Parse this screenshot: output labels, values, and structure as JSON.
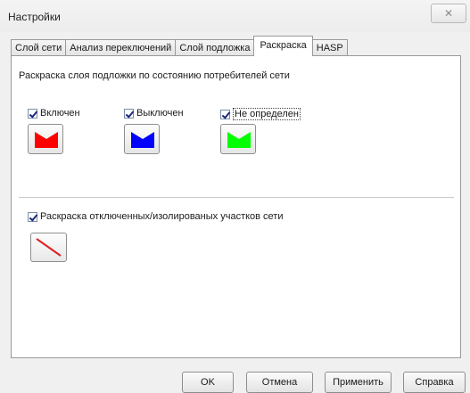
{
  "window": {
    "title": "Настройки",
    "close_glyph": "✕"
  },
  "tabs": [
    {
      "label": "Слой сети",
      "active": false
    },
    {
      "label": "Анализ переключений",
      "active": false
    },
    {
      "label": "Слой подложка",
      "active": false
    },
    {
      "label": "Раскраска",
      "active": true
    },
    {
      "label": "HASP",
      "active": false
    }
  ],
  "panel": {
    "heading": "Раскраска слоя подложки по состоянию потребителей сети",
    "states": [
      {
        "label": "Включен",
        "checked": true,
        "color": "#ff0000",
        "icon": "colored-flag-swatch-icon"
      },
      {
        "label": "Выключен",
        "checked": true,
        "color": "#0000ff",
        "icon": "colored-flag-swatch-icon"
      },
      {
        "label": "Не определен",
        "checked": true,
        "color": "#00ff00",
        "icon": "colored-flag-swatch-icon"
      }
    ],
    "isolated": {
      "label": "Раскраска отключенных/изолированых участков сети",
      "checked": true,
      "line_color": "#e02020",
      "icon": "diagonal-line-icon"
    }
  },
  "footer": {
    "ok": "OK",
    "cancel": "Отмена",
    "apply": "Применить",
    "help": "Справка"
  }
}
